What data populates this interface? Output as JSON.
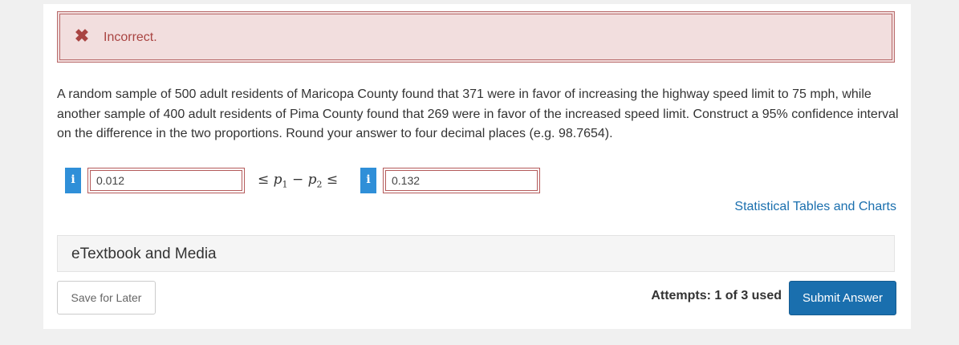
{
  "feedback": {
    "icon": "close-icon",
    "message": "Incorrect."
  },
  "question": {
    "text": "A random sample of 500 adult residents of Maricopa County found that 371 were in favor of increasing the highway speed limit to 75 mph, while another sample of 400 adult residents of Pima County found that 269 were in favor of the increased speed limit. Construct a 95% confidence interval on the difference in the two proportions. Round your answer to four decimal places (e.g. 98.7654)."
  },
  "answer": {
    "info_glyph": "i",
    "lower_value": "0.012",
    "upper_value": "0.132",
    "leq": "≤",
    "p1": "p",
    "sub1": "1",
    "minus": "−",
    "p2": "p",
    "sub2": "2"
  },
  "links": {
    "statistical_tables": "Statistical Tables and Charts"
  },
  "etextbook": {
    "label": "eTextbook and Media"
  },
  "footer": {
    "save_label": "Save for Later",
    "attempts": "Attempts: 1 of 3 used",
    "submit_label": "Submit Answer"
  },
  "colors": {
    "error_bg": "#f2dede",
    "error_text": "#a94442",
    "info_badge": "#2f8fd8",
    "link": "#1a6fae",
    "primary_button": "#1a6fae"
  }
}
